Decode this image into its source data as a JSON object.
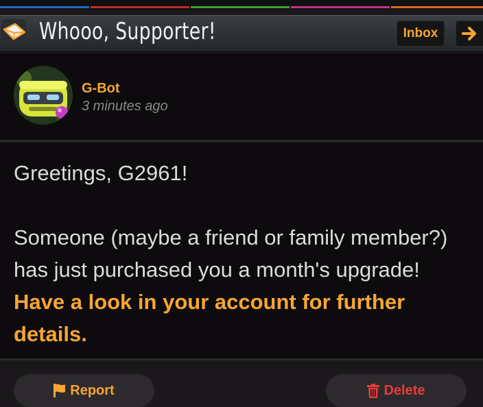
{
  "colors": {
    "accent": "#f7a535",
    "danger": "#ec3b3b",
    "strip": [
      "#1e68c2",
      "#c92a2a",
      "#3aa33a",
      "#c82f8f",
      "#e8631c"
    ]
  },
  "header": {
    "title": "Whooo, Supporter!",
    "inbox_label": "Inbox",
    "envelope_icon": "envelope-icon",
    "next_icon": "arrow-right-icon"
  },
  "sender": {
    "name": "G-Bot",
    "time": "3 minutes ago",
    "avatar_icon": "robot-avatar"
  },
  "message": {
    "greeting": "Greetings, G2961!",
    "body_prefix": "Someone (maybe a friend or family member?) has just purchased you a month's upgrade! ",
    "body_highlight": "Have a look in your account for further details."
  },
  "actions": {
    "report_label": "Report",
    "report_icon": "flag-icon",
    "delete_label": "Delete",
    "delete_icon": "trash-icon"
  }
}
